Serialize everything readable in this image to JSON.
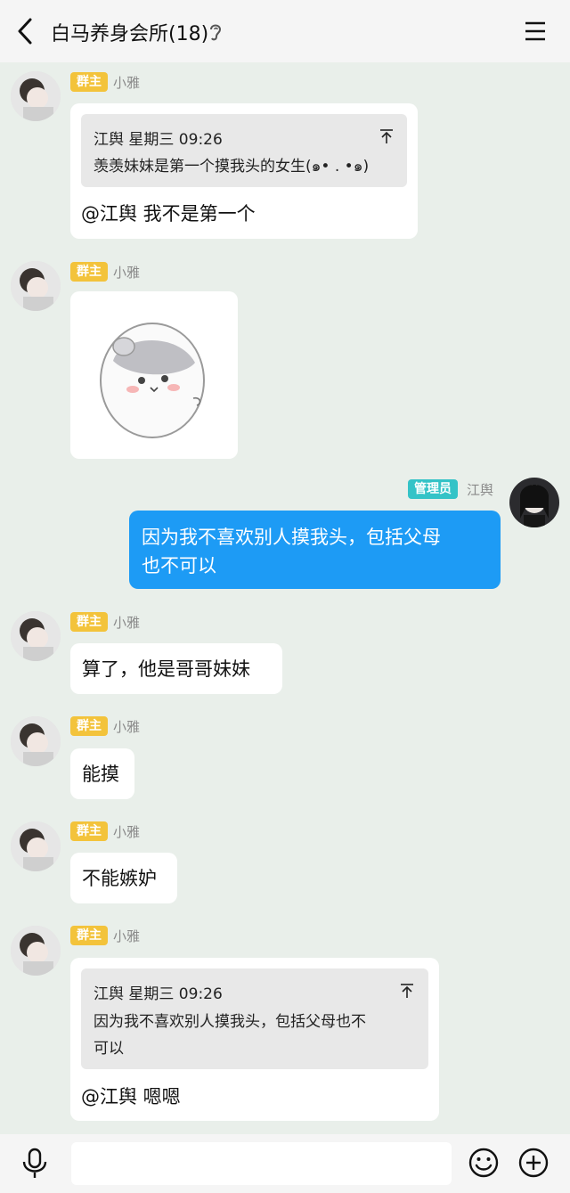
{
  "header": {
    "title": "白马养身会所(18)"
  },
  "messages": [
    {
      "badge": "群主",
      "sender": "小雅",
      "quote_header": "江舆 星期三 09:26",
      "quote_text": "羡羡妹妹是第一个摸我头的女生(๑• . •๑)",
      "text": "@江舆 我不是第一个"
    },
    {
      "badge": "群主",
      "sender": "小雅",
      "sticker": "hamster-sticker"
    },
    {
      "badge": "管理员",
      "sender": "江舆",
      "text_line1": "因为我不喜欢别人摸我头，包括父母",
      "text_line2": "也不可以"
    },
    {
      "badge": "群主",
      "sender": "小雅",
      "text": "算了，他是哥哥妹妹"
    },
    {
      "badge": "群主",
      "sender": "小雅",
      "text": "能摸"
    },
    {
      "badge": "群主",
      "sender": "小雅",
      "text": "不能嫉妒"
    },
    {
      "badge": "群主",
      "sender": "小雅",
      "quote_header": "江舆 星期三 09:26",
      "quote_line1": "因为我不喜欢别人摸我头，包括父母也不",
      "quote_line2": "可以",
      "text": "@江舆 嗯嗯"
    }
  ],
  "colors": {
    "owner_badge": "#f3c33b",
    "admin_badge": "#34c3c7",
    "my_bubble": "#1d9bf5",
    "background": "#e9efea"
  }
}
